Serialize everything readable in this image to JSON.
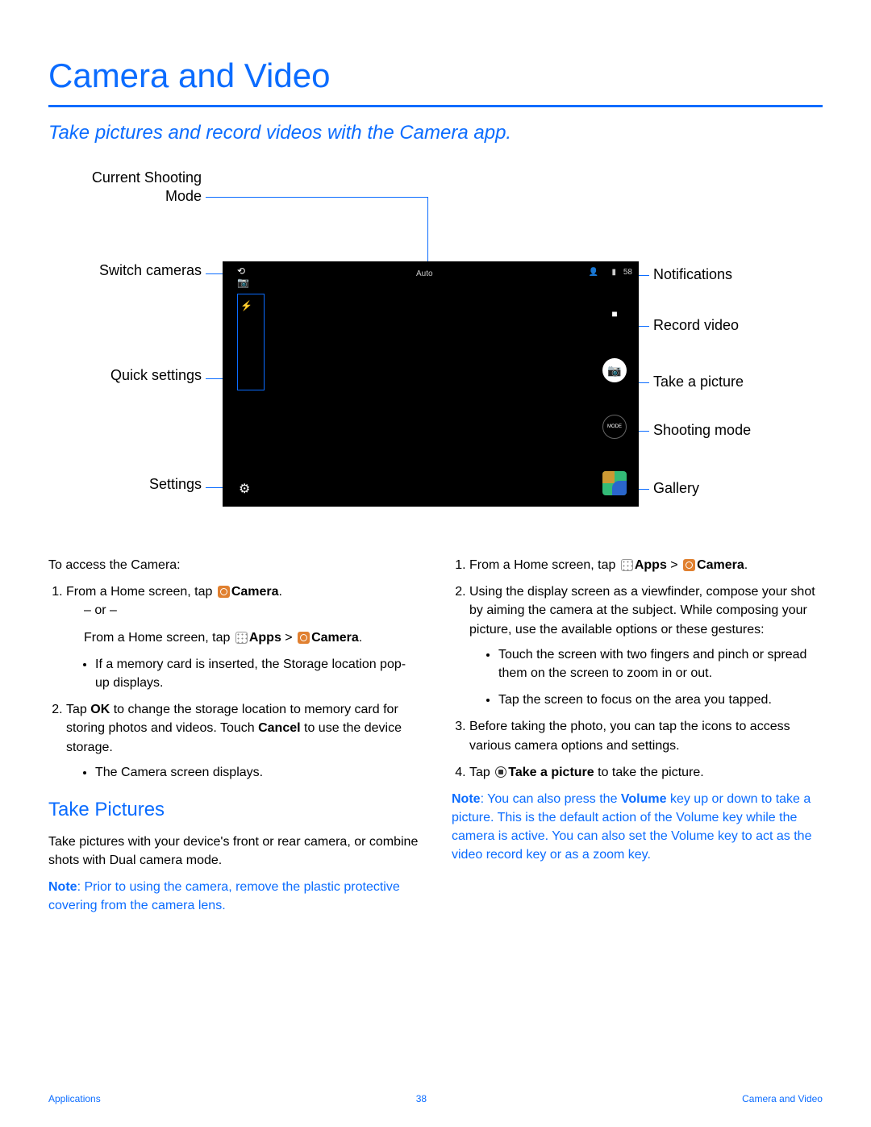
{
  "page": {
    "title": "Camera and Video",
    "subtitle": "Take pictures and record videos with the Camera app."
  },
  "diagram": {
    "labels": {
      "current_mode": "Current Shooting Mode",
      "switch": "Switch cameras",
      "quick": "Quick settings",
      "settings": "Settings",
      "notif": "Notifications",
      "record": "Record video",
      "take": "Take a picture",
      "shoot_mode": "Shooting mode",
      "gallery": "Gallery"
    },
    "screenshot": {
      "mode_text": "Auto",
      "count": "58",
      "mode_btn": "MODE"
    }
  },
  "left": {
    "intro": "To access the Camera:",
    "s1a": "From a Home screen, tap ",
    "s1b": "Camera",
    "or": "– or –",
    "s1c": "From a Home screen, tap ",
    "s1d": "Apps",
    "s1e": " > ",
    "s1f": "Camera",
    "bul1": "If a memory card is inserted, the Storage location pop-up displays.",
    "s2a": "Tap ",
    "s2b": "OK",
    "s2c": " to change the storage location to memory card for storing photos and videos. Touch ",
    "s2d": "Cancel",
    "s2e": " to use the device storage.",
    "bul2": "The Camera screen displays.",
    "h2": "Take Pictures",
    "p2": "Take pictures with your device's front or rear camera, or combine shots with Dual camera mode.",
    "note_label": "Note",
    "note": ": Prior to using the camera, remove the plastic protective covering from the camera lens."
  },
  "right": {
    "s1a": "From a Home screen, tap ",
    "s1b": "Apps",
    "s1c": " > ",
    "s1d": "Camera",
    "s2": "Using the display screen as a viewfinder, compose your shot by aiming the camera at the subject. While composing your picture, use the available options or these gestures:",
    "b1": "Touch the screen with two fingers and pinch or spread them on the screen to zoom in or out.",
    "b2": "Tap the screen to focus on the area you tapped.",
    "s3": "Before taking the photo, you can tap the icons to access various camera options and settings.",
    "s4a": "Tap ",
    "s4b": "Take a picture",
    "s4c": " to take the picture.",
    "note_label": "Note",
    "note": ": You can also press the ",
    "note_b": "Volume",
    "note2": " key up or down to take a picture. This is the default action of the Volume key while the camera is active. You can also set the Volume key to act as the video record key or as a zoom key."
  },
  "footer": {
    "left": "Applications",
    "center": "38",
    "right": "Camera and Video"
  }
}
